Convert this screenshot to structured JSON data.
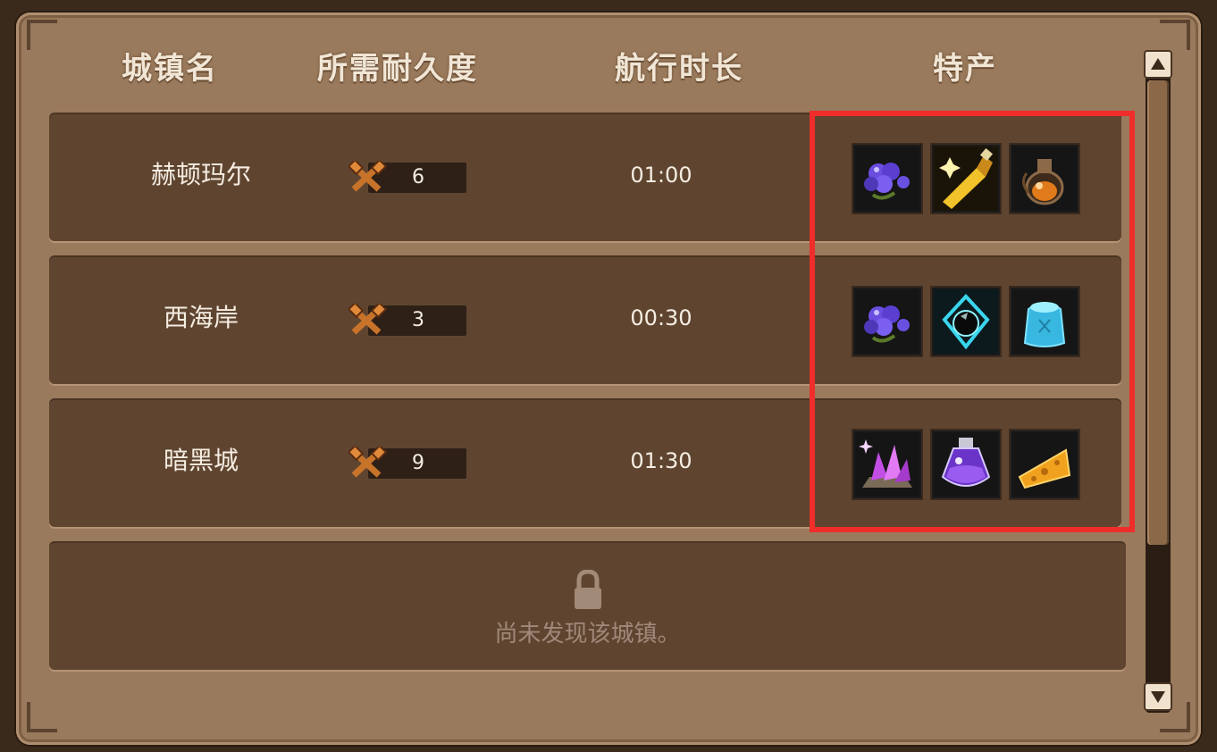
{
  "header": {
    "town_name": "城镇名",
    "durability": "所需耐久度",
    "sail_time": "航行时长",
    "specialty": "特产"
  },
  "towns": [
    {
      "name": "赫顿玛尔",
      "durability": "6",
      "time": "01:00",
      "items": [
        "purple-berry-cluster-icon",
        "golden-potion-bottle-icon",
        "amber-flask-icon"
      ]
    },
    {
      "name": "西海岸",
      "durability": "3",
      "time": "00:30",
      "items": [
        "purple-berry-cluster-icon",
        "dark-crystal-orb-icon",
        "blue-jelly-icon"
      ]
    },
    {
      "name": "暗黑城",
      "durability": "9",
      "time": "01:30",
      "items": [
        "violet-crystal-icon",
        "purple-potion-icon",
        "cheese-wedge-icon"
      ]
    }
  ],
  "locked": {
    "message": "尚未发现该城镇。",
    "icon": "lock-icon"
  },
  "colors": {
    "highlight": "#ef2d2a",
    "panel": "#9a7a5c",
    "row": "#5f4530"
  }
}
